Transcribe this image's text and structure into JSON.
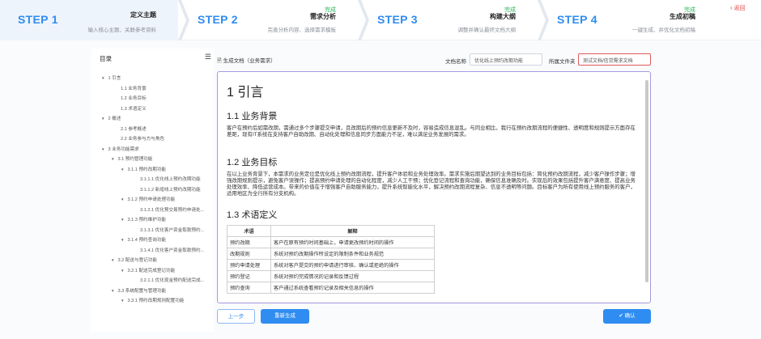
{
  "steps": [
    {
      "num": "STEP 1",
      "status": "",
      "title": "定义主题",
      "desc": "输入核心主题、关联参考资料"
    },
    {
      "num": "STEP 2",
      "status": "完成",
      "title": "需求分析",
      "desc": "完善分析内容、选择需求模板"
    },
    {
      "num": "STEP 3",
      "status": "完成",
      "title": "构建大纲",
      "desc": "调整并确认最终文档大纲"
    },
    {
      "num": "STEP 4",
      "status": "完成",
      "title": "生成初稿",
      "desc": "一键生成、并优化文档初稿"
    }
  ],
  "back_label": "返回",
  "sidebar": {
    "title": "目录",
    "items": [
      {
        "label": "1 引言",
        "expanded": true
      },
      {
        "label": "1.1 业务背景"
      },
      {
        "label": "1.2 业务目标"
      },
      {
        "label": "1.3 术语定义"
      },
      {
        "label": "2 概述",
        "expanded": true
      },
      {
        "label": "2.1 参考概述"
      },
      {
        "label": "2.2 业务参与方与角色"
      },
      {
        "label": "3 业务功能需求",
        "expanded": true
      },
      {
        "label": "3.1 预约管理功能",
        "expanded": true
      },
      {
        "label": "3.1.1 预约改期功能",
        "expanded": true
      },
      {
        "label": "3.1.1.1 优化线上预约改期功能"
      },
      {
        "label": "3.1.1.2 新增线上预约改期功能"
      },
      {
        "label": "3.1.2 预约申请处理功能",
        "expanded": true
      },
      {
        "label": "3.1.2.1 优化预交易预约申请处..."
      },
      {
        "label": "3.1.3 预约维护功能",
        "expanded": true
      },
      {
        "label": "3.1.3.1 优化客户资金取款预约..."
      },
      {
        "label": "3.1.4 预约查询功能",
        "expanded": true
      },
      {
        "label": "3.1.4.1 优化客户资金取款预约..."
      },
      {
        "label": "3.2 配送与登记功能",
        "expanded": true
      },
      {
        "label": "3.2.1 配送完成登记功能",
        "expanded": true
      },
      {
        "label": "3.2.1.1 优化现金预约配送完成..."
      },
      {
        "label": "3.3 系统配置与管理功能",
        "expanded": true
      },
      {
        "label": "3.3.1 预约改期规则配置功能",
        "expanded": true
      }
    ]
  },
  "doc_header": {
    "title": "生成文档（业务需求）",
    "name_label": "文档名称",
    "name_value": "优化线上预约改期功能",
    "folder_label": "所属文件夹",
    "folder_value": "测试文档/信贷需求文档"
  },
  "document": {
    "h1": "1 引言",
    "s1_title": "1.1 业务背景",
    "s1_body": "客户在预约后如需改期，需通过多个步骤提交申请，且改期后的预约信息更新不及时，容易造成信息混乱。与同业相比，我行在预约改期流程的便捷性、透明度和规则提示方面存在差距，现有IT系统在支持客户自助改期、自动化处理和信息同步方面能力不足，难以满足业务发展的需求。",
    "s2_title": "1.2 业务目标",
    "s2_body": "在以上业务背景下，本需求的业务定位是优化线上预约改期流程，提升客户体验和业务处理效率。需求实施后期望达到的业务目标包括：简化预约改期流程，减少客户操作步骤；增强改期规则提示，避免客户误操作；提高预约申请处理的自动化程度，减少人工干预；优化登记流程和查询功能，确保信息准确及时。实现后的效果包括提升客户满意度、提高业务处理效率、降低运营成本。带来的价值在于增强客户自助服务能力，提升系统智能化水平，解决预约改期流程复杂、信息不透明等问题。目标客户为所有使用线上预约服务的客户，适用地区为全行所有分支机构。",
    "s3_title": "1.3 术语定义",
    "terms_headers": [
      "术语",
      "解释"
    ],
    "terms": [
      [
        "预约改期",
        "客户在原有预约时间基础上，申请更改预约时间的操作"
      ],
      [
        "改期规则",
        "系统对预约改期操作所设定的限制条件和业务规范"
      ],
      [
        "预约申请处理",
        "系统对客户提交的预约申请进行审核、确认或拒绝的操作"
      ],
      [
        "预约登记",
        "系统对预约完成情况的记录和反馈过程"
      ],
      [
        "预约查询",
        "客户通过系统查看预约记录及相关信息的操作"
      ]
    ]
  },
  "buttons": {
    "prev": "上一步",
    "regen": "重新生成",
    "confirm": "确认"
  },
  "colors": {
    "accent": "#2f8cf0",
    "done": "#2db55d",
    "card_border": "#a49ae0",
    "back": "#e04848"
  }
}
